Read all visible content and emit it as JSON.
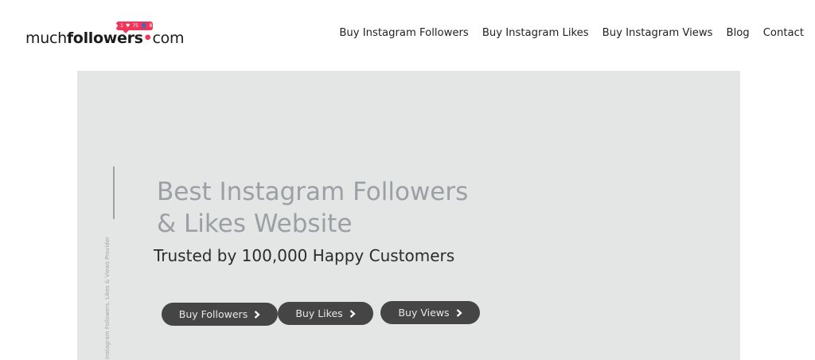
{
  "logo": {
    "part1": "much",
    "part2": "followers",
    "dot": "•",
    "part3": "com",
    "badge": {
      "posts": "1",
      "likes": "75",
      "followers": "87"
    }
  },
  "nav": {
    "items": [
      "Buy Instagram Followers",
      "Buy Instagram Likes",
      "Buy Instagram Views",
      "Blog",
      "Contact"
    ]
  },
  "hero": {
    "title_line1": "Best Instagram Followers",
    "title_line2": "& Likes Website",
    "subtitle": "Trusted by 100,000 Happy Customers",
    "vertical_text": "Instagram Followers, Likes & Views Provider",
    "buttons": {
      "followers": "Buy Followers",
      "likes": "Buy Likes",
      "views": "Buy Views"
    }
  },
  "colors": {
    "brand": "#f0365b",
    "hero_bg": "#e4e6e5",
    "button_bg": "#454545",
    "title_gray": "#9ba0a4"
  }
}
